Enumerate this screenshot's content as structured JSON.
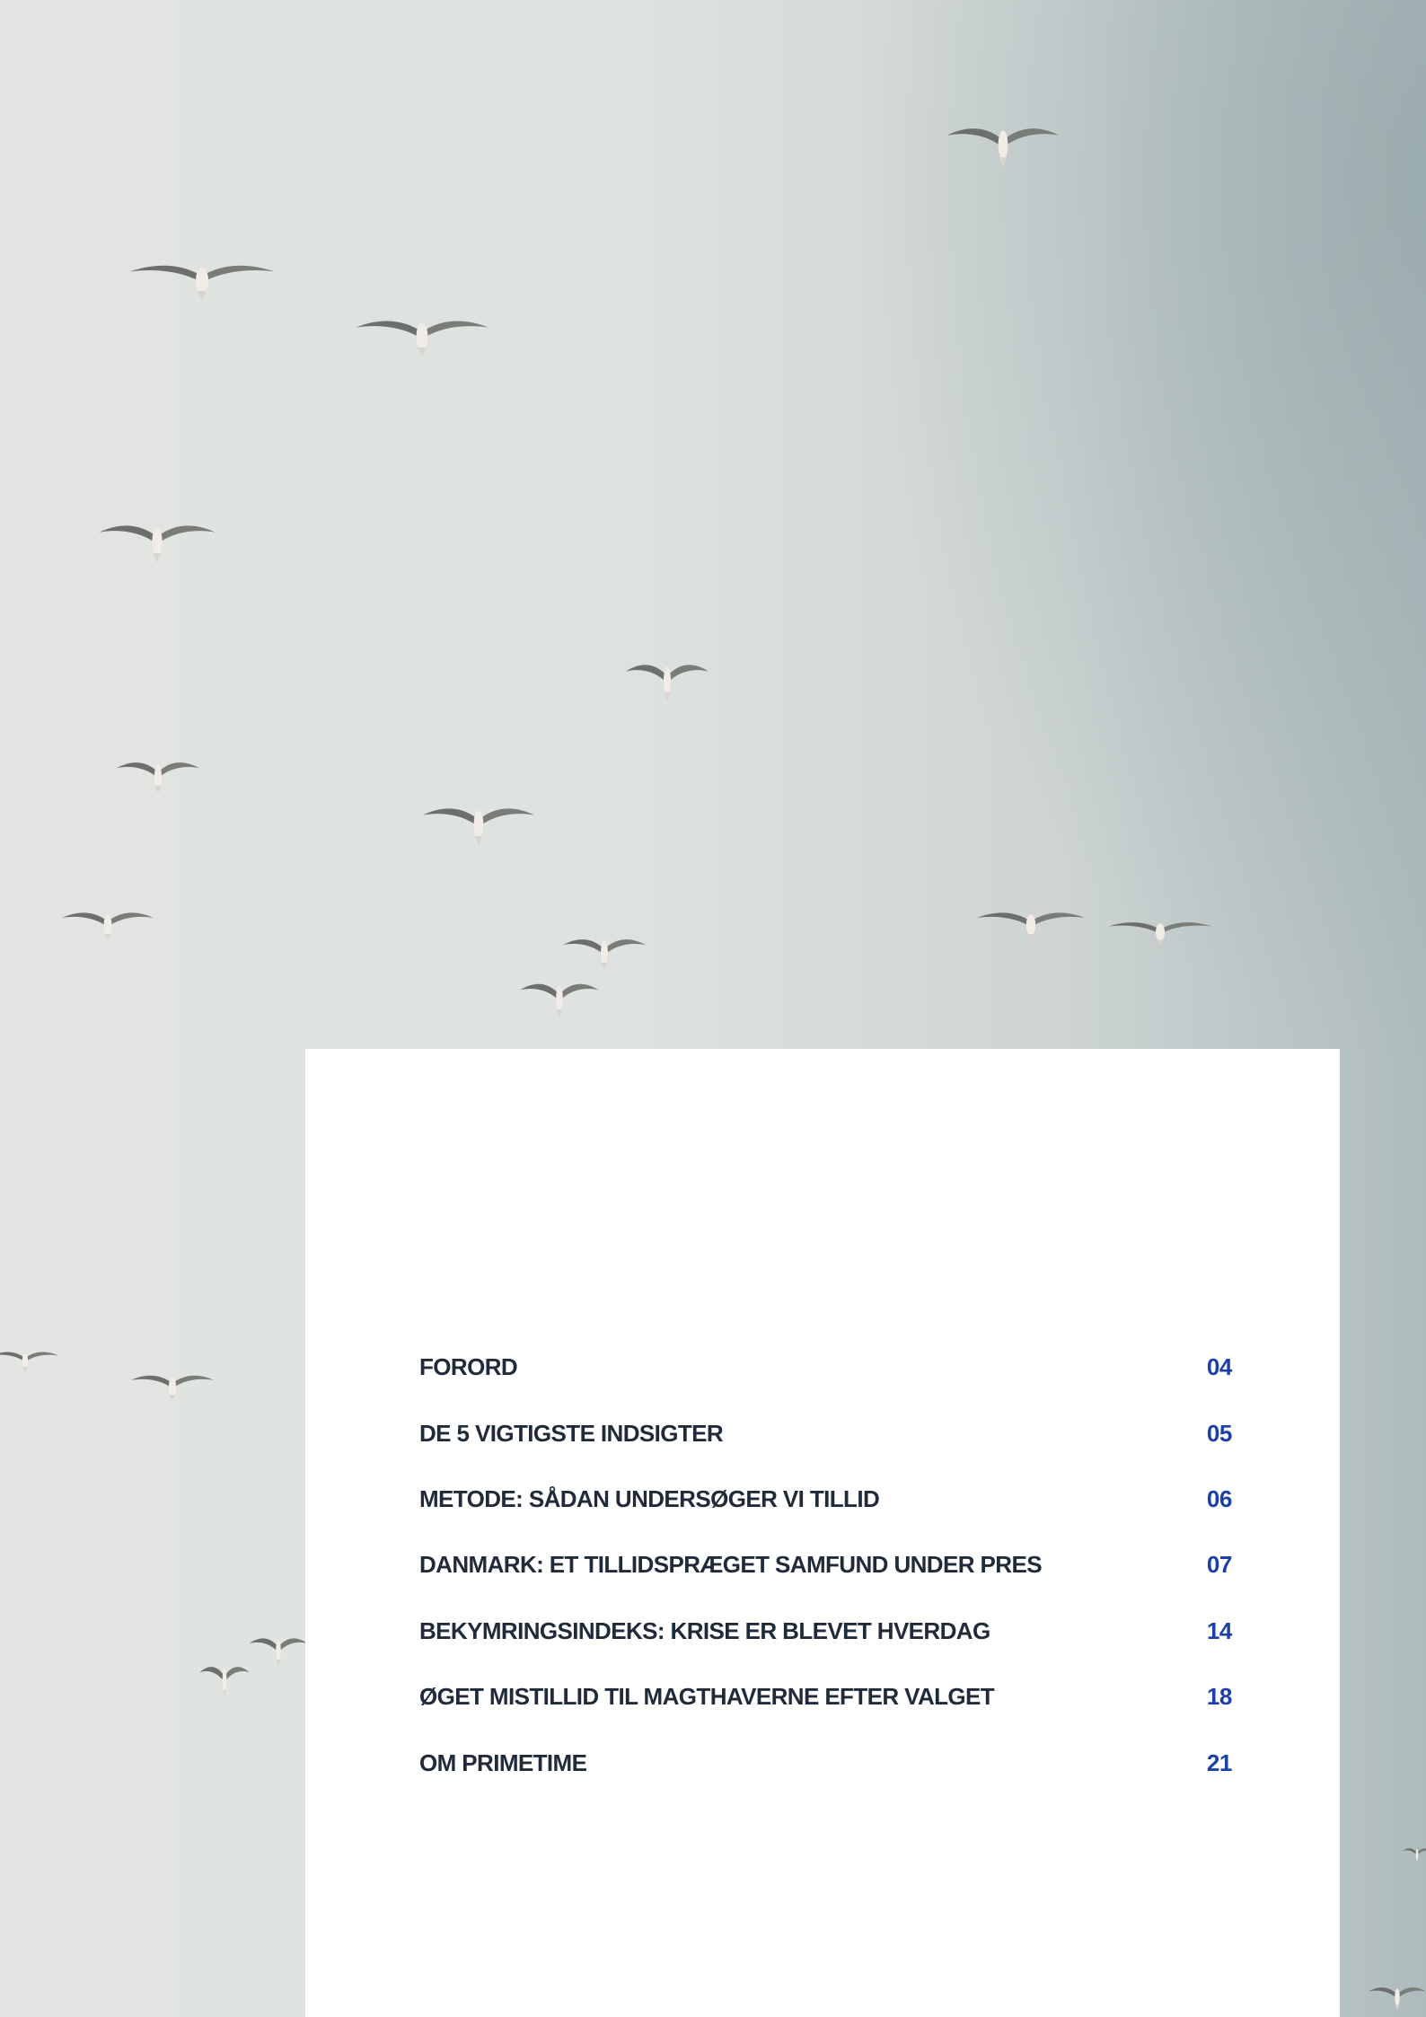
{
  "colors": {
    "heading_text": "#1f2b3a",
    "page_number": "#1d3fa8",
    "card_background": "#ffffff"
  },
  "toc": {
    "entries": [
      {
        "title": "FORORD",
        "page": "04"
      },
      {
        "title": "DE 5 VIGTIGSTE INDSIGTER",
        "page": "05"
      },
      {
        "title": "METODE: SÅDAN UNDERSØGER VI TILLID",
        "page": "06"
      },
      {
        "title": "DANMARK: ET TILLIDSPRÆGET SAMFUND UNDER PRES",
        "page": "07"
      },
      {
        "title": "BEKYMRINGSINDEKS: KRISE ER BLEVET HVERDAG",
        "page": "14"
      },
      {
        "title": "ØGET MISTILLID TIL MAGTHAVERNE EFTER VALGET",
        "page": "18"
      },
      {
        "title": "OM PRIMETIME",
        "page": "21"
      }
    ]
  }
}
